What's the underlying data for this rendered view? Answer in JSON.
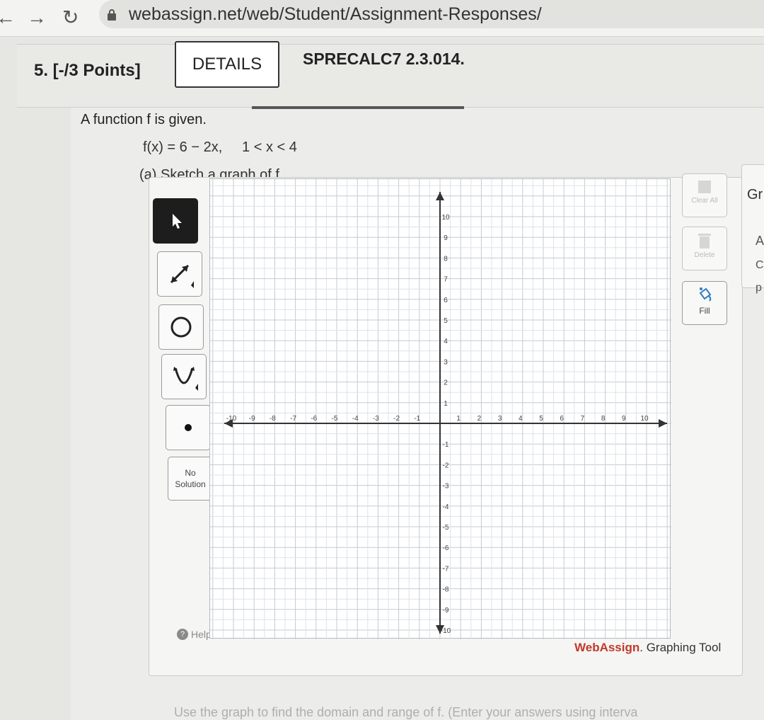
{
  "browser": {
    "url": "webassign.net/web/Student/Assignment-Responses/"
  },
  "question": {
    "number_points": "5.  [-/3 Points]",
    "details_label": "DETAILS",
    "code": "SPRECALC7 2.3.014.",
    "prompt": "A function f is given.",
    "formula": "f(x) = 6 − 2x,     1 < x < 4",
    "part_a": "(a) Sketch a graph of f."
  },
  "graph_tool": {
    "no_solution": [
      "No",
      "Solution"
    ],
    "help": "Help",
    "clear_all": "Clear All",
    "delete": "Delete",
    "fill": "Fill",
    "brand_web": "WebAssign",
    "brand_tool": ". Graphing Tool",
    "x_range": [
      -10,
      10
    ],
    "y_range": [
      -10,
      10
    ]
  },
  "right_panel": {
    "title": "Gr",
    "line1": "A",
    "line2": "C",
    "line3": "p"
  },
  "footer_text": "Use the graph to find the domain and range of f. (Enter your answers using interva"
}
